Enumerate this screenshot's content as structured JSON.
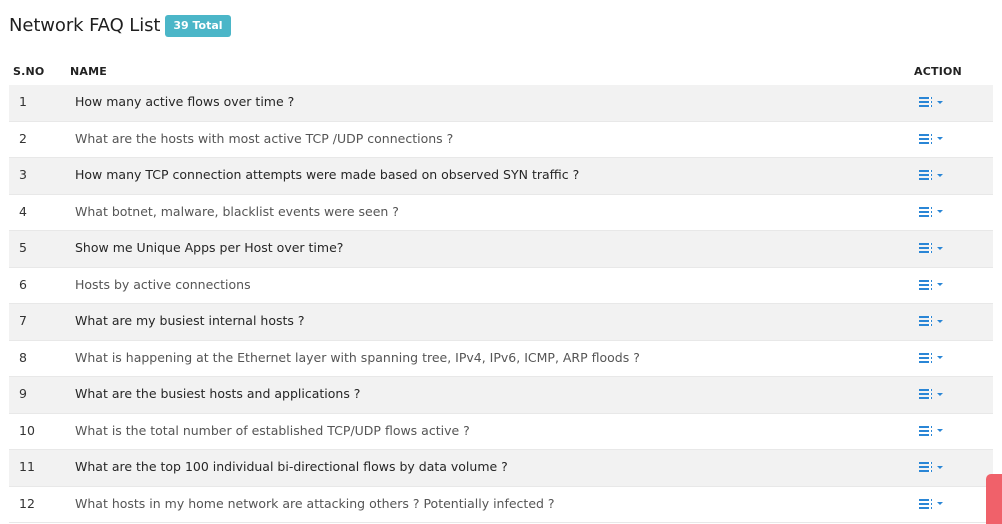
{
  "header": {
    "title": "Network FAQ List",
    "badge": "39 Total"
  },
  "table": {
    "columns": {
      "sno": "S.NO",
      "name": "NAME",
      "action": "ACTION"
    },
    "rows": [
      {
        "sno": "1",
        "name": "How many active flows over time ?"
      },
      {
        "sno": "2",
        "name": "What are the hosts with most active TCP /UDP connections ?"
      },
      {
        "sno": "3",
        "name": "How many TCP connection attempts were made based on observed SYN traffic ?"
      },
      {
        "sno": "4",
        "name": "What botnet, malware, blacklist events were seen ?"
      },
      {
        "sno": "5",
        "name": "Show me Unique Apps per Host over time?"
      },
      {
        "sno": "6",
        "name": "Hosts by active connections"
      },
      {
        "sno": "7",
        "name": "What are my busiest internal hosts ?"
      },
      {
        "sno": "8",
        "name": "What is happening at the Ethernet layer with spanning tree, IPv4, IPv6, ICMP, ARP floods ?"
      },
      {
        "sno": "9",
        "name": "What are the busiest hosts and applications ?"
      },
      {
        "sno": "10",
        "name": "What is the total number of established TCP/UDP flows active ?"
      },
      {
        "sno": "11",
        "name": "What are the top 100 individual bi-directional flows by data volume ?"
      },
      {
        "sno": "12",
        "name": "What hosts in my home network are attacking others ? Potentially infected ?"
      }
    ]
  },
  "icons": {
    "action": "list-dropdown-icon",
    "side_tab": "feedback-tab"
  },
  "colors": {
    "badge": "#4bb6c8",
    "action_icon": "#2a86d6",
    "row_stripe": "#f2f2f2",
    "side_tab": "#f0616a"
  }
}
